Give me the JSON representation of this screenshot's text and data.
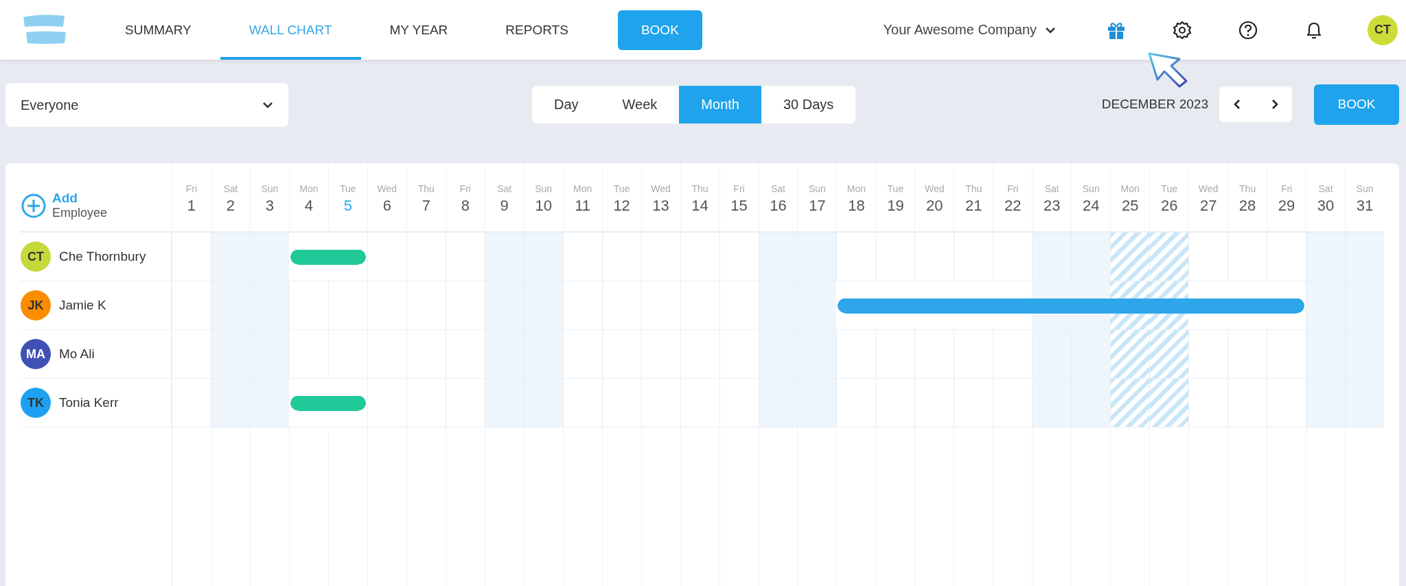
{
  "top_bar": {
    "nav": [
      {
        "label": "SUMMARY",
        "selected": false
      },
      {
        "label": "WALL CHART",
        "selected": true
      },
      {
        "label": "MY YEAR",
        "selected": false
      },
      {
        "label": "REPORTS",
        "selected": false
      }
    ],
    "book_button": "BOOK",
    "company": "Your Awesome Company",
    "user_initials": "CT"
  },
  "toolbar": {
    "filter": {
      "value": "Everyone"
    },
    "views": [
      {
        "label": "Day",
        "selected": false
      },
      {
        "label": "Week",
        "selected": false
      },
      {
        "label": "Month",
        "selected": true
      },
      {
        "label": "30 Days",
        "selected": false
      }
    ],
    "period": "DECEMBER 2023",
    "book_button": "BOOK"
  },
  "wall_chart": {
    "add_employee": {
      "action": "Add",
      "label": "Employee"
    },
    "days": [
      {
        "weekday": "Fri",
        "date": "1",
        "kind": "workday",
        "today": false
      },
      {
        "weekday": "Sat",
        "date": "2",
        "kind": "weekend",
        "today": false
      },
      {
        "weekday": "Sun",
        "date": "3",
        "kind": "weekend",
        "today": false
      },
      {
        "weekday": "Mon",
        "date": "4",
        "kind": "workday",
        "today": false
      },
      {
        "weekday": "Tue",
        "date": "5",
        "kind": "workday",
        "today": true
      },
      {
        "weekday": "Wed",
        "date": "6",
        "kind": "workday",
        "today": false
      },
      {
        "weekday": "Thu",
        "date": "7",
        "kind": "workday",
        "today": false
      },
      {
        "weekday": "Fri",
        "date": "8",
        "kind": "workday",
        "today": false
      },
      {
        "weekday": "Sat",
        "date": "9",
        "kind": "weekend",
        "today": false
      },
      {
        "weekday": "Sun",
        "date": "10",
        "kind": "weekend",
        "today": false
      },
      {
        "weekday": "Mon",
        "date": "11",
        "kind": "workday",
        "today": false
      },
      {
        "weekday": "Tue",
        "date": "12",
        "kind": "workday",
        "today": false
      },
      {
        "weekday": "Wed",
        "date": "13",
        "kind": "workday",
        "today": false
      },
      {
        "weekday": "Thu",
        "date": "14",
        "kind": "workday",
        "today": false
      },
      {
        "weekday": "Fri",
        "date": "15",
        "kind": "workday",
        "today": false
      },
      {
        "weekday": "Sat",
        "date": "16",
        "kind": "weekend",
        "today": false
      },
      {
        "weekday": "Sun",
        "date": "17",
        "kind": "weekend",
        "today": false
      },
      {
        "weekday": "Mon",
        "date": "18",
        "kind": "workday",
        "today": false
      },
      {
        "weekday": "Tue",
        "date": "19",
        "kind": "workday",
        "today": false
      },
      {
        "weekday": "Wed",
        "date": "20",
        "kind": "workday",
        "today": false
      },
      {
        "weekday": "Thu",
        "date": "21",
        "kind": "workday",
        "today": false
      },
      {
        "weekday": "Fri",
        "date": "22",
        "kind": "workday",
        "today": false
      },
      {
        "weekday": "Sat",
        "date": "23",
        "kind": "weekend",
        "today": false
      },
      {
        "weekday": "Sun",
        "date": "24",
        "kind": "weekend",
        "today": false
      },
      {
        "weekday": "Mon",
        "date": "25",
        "kind": "holiday",
        "today": false
      },
      {
        "weekday": "Tue",
        "date": "26",
        "kind": "holiday",
        "today": false
      },
      {
        "weekday": "Wed",
        "date": "27",
        "kind": "workday",
        "today": false
      },
      {
        "weekday": "Thu",
        "date": "28",
        "kind": "workday",
        "today": false
      },
      {
        "weekday": "Fri",
        "date": "29",
        "kind": "workday",
        "today": false
      },
      {
        "weekday": "Sat",
        "date": "30",
        "kind": "weekend",
        "today": false
      },
      {
        "weekday": "Sun",
        "date": "31",
        "kind": "weekend",
        "today": false
      }
    ],
    "employees": [
      {
        "initials": "CT",
        "name": "Che Thornbury",
        "color": "#c6d93b",
        "booking": {
          "color": "#21c998"
        },
        "days": [
          {
            "booked": false
          },
          {
            "booked": false
          },
          {
            "booked": false
          },
          {
            "booked": true
          },
          {
            "booked": true
          },
          {
            "booked": false
          },
          {
            "booked": false
          },
          {
            "booked": false
          },
          {
            "booked": false
          },
          {
            "booked": false
          },
          {
            "booked": false
          },
          {
            "booked": false
          },
          {
            "booked": false
          },
          {
            "booked": false
          },
          {
            "booked": false
          },
          {
            "booked": false
          },
          {
            "booked": false
          },
          {
            "booked": false
          },
          {
            "booked": false
          },
          {
            "booked": false
          },
          {
            "booked": false
          },
          {
            "booked": false
          },
          {
            "booked": false
          },
          {
            "booked": false
          },
          {
            "booked": false
          },
          {
            "booked": false
          },
          {
            "booked": false
          },
          {
            "booked": false
          },
          {
            "booked": false
          },
          {
            "booked": false
          },
          {
            "booked": false
          }
        ]
      },
      {
        "initials": "JK",
        "name": "Jamie K",
        "color": "#fb8c00",
        "booking": {
          "color": "#2ea6ea"
        },
        "days": [
          {
            "booked": false
          },
          {
            "booked": false
          },
          {
            "booked": false
          },
          {
            "booked": false
          },
          {
            "booked": false
          },
          {
            "booked": false
          },
          {
            "booked": false
          },
          {
            "booked": false
          },
          {
            "booked": false
          },
          {
            "booked": false
          },
          {
            "booked": false
          },
          {
            "booked": false
          },
          {
            "booked": false
          },
          {
            "booked": false
          },
          {
            "booked": false
          },
          {
            "booked": false
          },
          {
            "booked": false
          },
          {
            "booked": true
          },
          {
            "booked": true
          },
          {
            "booked": true
          },
          {
            "booked": true
          },
          {
            "booked": true
          },
          {
            "booked": true
          },
          {
            "booked": true
          },
          {
            "booked": true
          },
          {
            "booked": true
          },
          {
            "booked": true
          },
          {
            "booked": true
          },
          {
            "booked": true
          },
          {
            "booked": false
          },
          {
            "booked": false
          }
        ]
      },
      {
        "initials": "MA",
        "name": "Mo Ali",
        "color": "#3f51b5",
        "days": [
          {
            "booked": false
          },
          {
            "booked": false
          },
          {
            "booked": false
          },
          {
            "booked": false
          },
          {
            "booked": false
          },
          {
            "booked": false
          },
          {
            "booked": false
          },
          {
            "booked": false
          },
          {
            "booked": false
          },
          {
            "booked": false
          },
          {
            "booked": false
          },
          {
            "booked": false
          },
          {
            "booked": false
          },
          {
            "booked": false
          },
          {
            "booked": false
          },
          {
            "booked": false
          },
          {
            "booked": false
          },
          {
            "booked": false
          },
          {
            "booked": false
          },
          {
            "booked": false
          },
          {
            "booked": false
          },
          {
            "booked": false
          },
          {
            "booked": false
          },
          {
            "booked": false
          },
          {
            "booked": false
          },
          {
            "booked": false
          },
          {
            "booked": false
          },
          {
            "booked": false
          },
          {
            "booked": false
          },
          {
            "booked": false
          },
          {
            "booked": false
          }
        ]
      },
      {
        "initials": "TK",
        "name": "Tonia Kerr",
        "color": "#1da1f2",
        "booking": {
          "color": "#21c998"
        },
        "days": [
          {
            "booked": false
          },
          {
            "booked": false
          },
          {
            "booked": false
          },
          {
            "booked": true
          },
          {
            "booked": true
          },
          {
            "booked": false
          },
          {
            "booked": false
          },
          {
            "booked": false
          },
          {
            "booked": false
          },
          {
            "booked": false
          },
          {
            "booked": false
          },
          {
            "booked": false
          },
          {
            "booked": false
          },
          {
            "booked": false
          },
          {
            "booked": false
          },
          {
            "booked": false
          },
          {
            "booked": false
          },
          {
            "booked": false
          },
          {
            "booked": false
          },
          {
            "booked": false
          },
          {
            "booked": false
          },
          {
            "booked": false
          },
          {
            "booked": false
          },
          {
            "booked": false
          },
          {
            "booked": false
          },
          {
            "booked": false
          },
          {
            "booked": false
          },
          {
            "booked": false
          },
          {
            "booked": false
          },
          {
            "booked": false
          },
          {
            "booked": false
          }
        ]
      }
    ]
  }
}
